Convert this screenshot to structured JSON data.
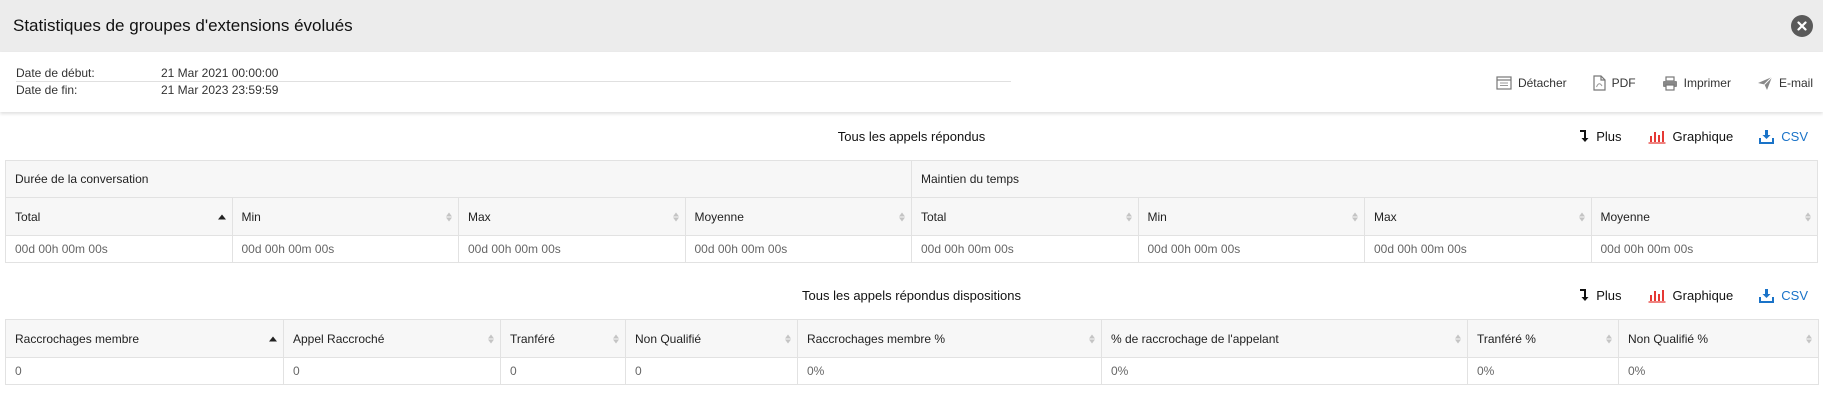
{
  "header": {
    "title": "Statistiques de groupes d'extensions évolués"
  },
  "dates": {
    "start_label": "Date de début:",
    "start_value": "21 Mar 2021 00:00:00",
    "end_label": "Date de fin:",
    "end_value": "21 Mar 2023 23:59:59"
  },
  "actions": {
    "detach": "Détacher",
    "pdf": "PDF",
    "print": "Imprimer",
    "email": "E-mail"
  },
  "section1": {
    "title": "Tous les appels répondus",
    "tools": {
      "more": "Plus",
      "chart": "Graphique",
      "csv": "CSV"
    },
    "groups": [
      "Durée de la conversation",
      "Maintien du temps"
    ],
    "columns": [
      "Total",
      "Min",
      "Max",
      "Moyenne",
      "Total",
      "Min",
      "Max",
      "Moyenne"
    ],
    "rows": [
      [
        "00d 00h 00m 00s",
        "00d 00h 00m 00s",
        "00d 00h 00m 00s",
        "00d 00h 00m 00s",
        "00d 00h 00m 00s",
        "00d 00h 00m 00s",
        "00d 00h 00m 00s",
        "00d 00h 00m 00s"
      ]
    ]
  },
  "section2": {
    "title": "Tous les appels répondus dispositions",
    "tools": {
      "more": "Plus",
      "chart": "Graphique",
      "csv": "CSV"
    },
    "columns": [
      "Raccrochages membre",
      "Appel Raccroché",
      "Tranféré",
      "Non Qualifié",
      "Raccrochages membre %",
      "% de raccrochage de l'appelant",
      "Tranféré %",
      "Non Qualifié %"
    ],
    "rows": [
      [
        "0",
        "0",
        "0",
        "0",
        "0%",
        "0%",
        "0%",
        "0%"
      ]
    ]
  },
  "colors": {
    "accent_blue": "#1a73c8",
    "chart_red": "#e53935",
    "header_bg": "#ececec"
  }
}
